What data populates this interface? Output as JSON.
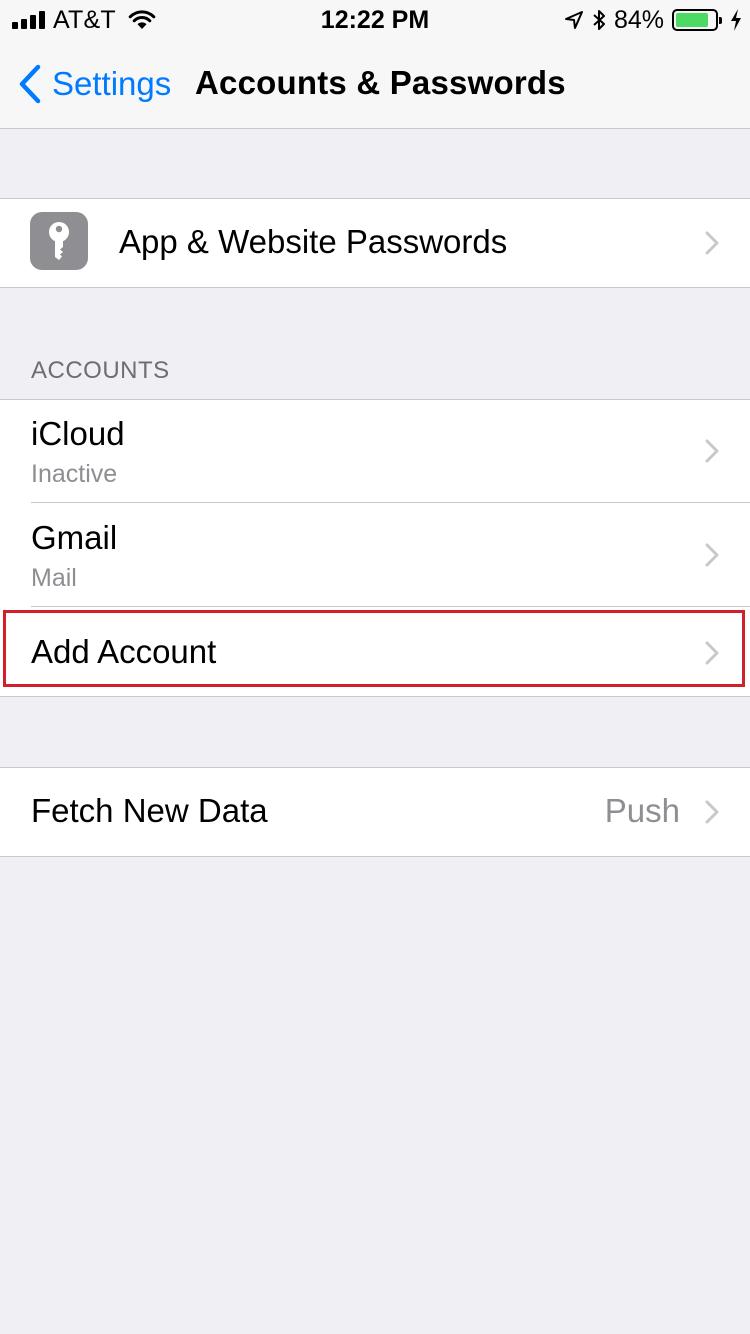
{
  "status_bar": {
    "carrier": "AT&T",
    "time": "12:22 PM",
    "battery_percent": "84%",
    "battery_level": 0.84,
    "icons": [
      "signal-bars-icon",
      "wifi-icon",
      "location-arrow-icon",
      "bluetooth-icon",
      "battery-icon",
      "charging-bolt-icon"
    ]
  },
  "nav": {
    "back_label": "Settings",
    "title": "Accounts & Passwords"
  },
  "passwords_row": {
    "label": "App & Website Passwords",
    "icon": "key-icon"
  },
  "accounts": {
    "header": "ACCOUNTS",
    "items": [
      {
        "title": "iCloud",
        "subtitle": "Inactive"
      },
      {
        "title": "Gmail",
        "subtitle": "Mail"
      }
    ],
    "add_label": "Add Account"
  },
  "fetch": {
    "label": "Fetch New Data",
    "value": "Push"
  },
  "colors": {
    "accent": "#007aff",
    "highlight": "#d0202a",
    "battery": "#4cd964",
    "background": "#efeff4"
  }
}
